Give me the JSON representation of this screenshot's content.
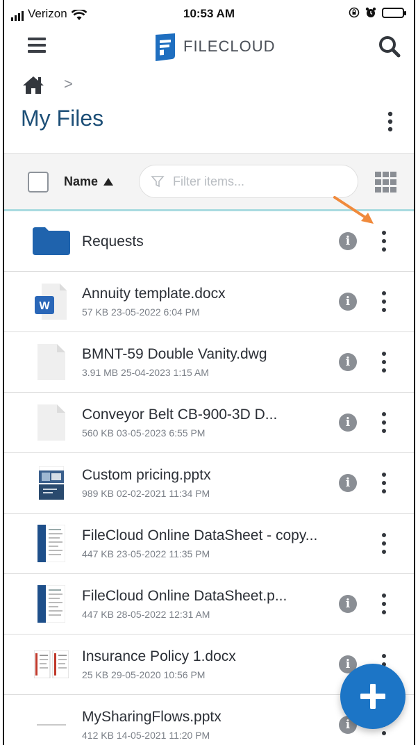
{
  "status": {
    "carrier": "Verizon",
    "time": "10:53 AM"
  },
  "header": {
    "brand": "FILECLOUD",
    "menu_icon": "hamburger-icon",
    "search_icon": "search-icon"
  },
  "breadcrumb": {
    "home_icon": "home-icon",
    "separator": ">"
  },
  "page": {
    "title": "My Files"
  },
  "toolbar": {
    "sort_label": "Name",
    "filter_placeholder": "Filter items..."
  },
  "files": [
    {
      "name": "Requests",
      "meta": "",
      "type": "folder"
    },
    {
      "name": "Annuity template.docx",
      "meta": "57 KB 23-05-2022 6:04 PM",
      "type": "word"
    },
    {
      "name": "BMNT-59 Double Vanity.dwg",
      "meta": "3.91 MB 25-04-2023 1:15 AM",
      "type": "generic"
    },
    {
      "name": "Conveyor Belt CB-900-3D D...",
      "meta": "560 KB 03-05-2023 6:55 PM",
      "type": "generic"
    },
    {
      "name": "Custom pricing.pptx",
      "meta": "989 KB 02-02-2021 11:34 PM",
      "type": "slide"
    },
    {
      "name": "FileCloud Online DataSheet - copy...",
      "meta": "447 KB 23-05-2022 11:35 PM",
      "type": "doc-thumb"
    },
    {
      "name": "FileCloud Online DataSheet.p...",
      "meta": "447 KB 28-05-2022 12:31 AM",
      "type": "doc-thumb"
    },
    {
      "name": "Insurance Policy 1.docx",
      "meta": "25 KB 29-05-2020 10:56 PM",
      "type": "form-thumb"
    },
    {
      "name": "MySharingFlows.pptx",
      "meta": "412 KB 14-05-2021 11:20 PM",
      "type": "text-thumb"
    }
  ],
  "colors": {
    "accent": "#1c75c6",
    "title": "#1d4f77",
    "annotation_arrow": "#f08a3c"
  }
}
